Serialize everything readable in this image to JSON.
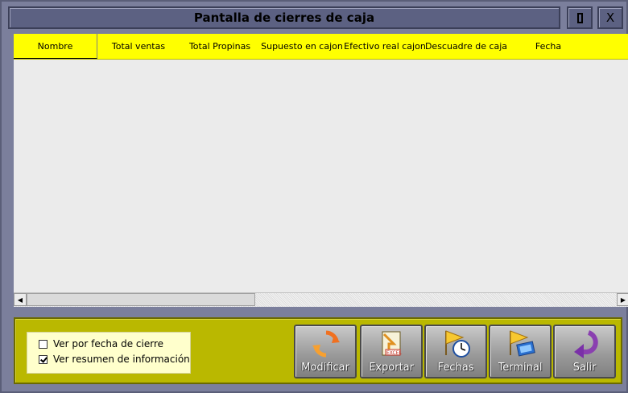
{
  "window": {
    "title": "Pantalla de cierres de caja",
    "close_label": "X"
  },
  "grid": {
    "columns": [
      "Nombre",
      "Total ventas",
      "Total Propinas",
      "Supuesto en cajon",
      "Efectivo real cajon",
      "Descuadre de caja",
      "Fecha"
    ],
    "rows": []
  },
  "options": {
    "ver_por_fecha": {
      "label": "Ver por fecha de cierre",
      "checked": false
    },
    "ver_resumen": {
      "label": "Ver resumen de información",
      "checked": true
    }
  },
  "buttons": {
    "modificar": "Modificar",
    "exportar": "Exportar",
    "fechas": "Fechas",
    "terminal": "Terminal",
    "salir": "Salir"
  },
  "icons": {
    "modificar": "refresh-icon",
    "exportar": "excel-export-icon",
    "fechas": "clock-flag-icon",
    "terminal": "computer-flag-icon",
    "salir": "exit-arrow-icon"
  },
  "colors": {
    "header": "#ffff00",
    "panel": "#bab800",
    "frame": "#7b7f9c"
  }
}
